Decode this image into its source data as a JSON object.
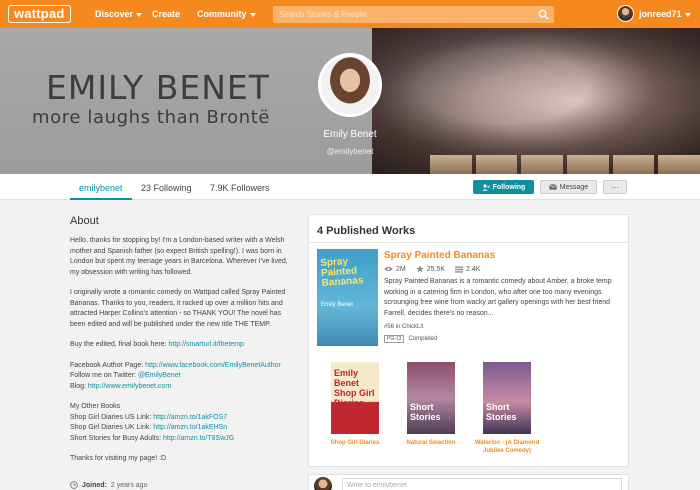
{
  "nav": {
    "logo": "wattpad",
    "discover": "Discover",
    "create": "Create",
    "community": "Community",
    "search_placeholder": "Search Stories & People",
    "username": "jonreed71"
  },
  "banner": {
    "title": "EMILY BENET",
    "tagline": "more laughs than Brontë",
    "name": "Emily Benet",
    "handle": "@emilybenet"
  },
  "tabs": {
    "handle": "emilybenet",
    "following": "23 Following",
    "followers": "7.9K Followers"
  },
  "actions": {
    "follow": "Following",
    "message": "Message",
    "more": "···"
  },
  "about": {
    "title": "About",
    "p1": "Hello, thanks for stopping by! I'm a London-based writer with a Welsh mother and Spanish father (so expect British spelling!). I was born in London but spent my teenage years in Barcelona. Wherever I've lived, my obsession with writing has followed.",
    "p2": "I originally wrote a romantic comedy on Wattpad called Spray Painted Bananas. Thanks to you, readers, it racked up over a million hits and attracted Harper Collins's attention - so THANK YOU! The novel has been edited and will be published under the new title THE TEMP.",
    "buy_label": "Buy the edited, final book here: ",
    "buy_link": "http://smarturl.it/thetemp",
    "fb_label": "Facebook Author Page: ",
    "fb_link": "http://www.facebook.com/EmilyBenetAuthor",
    "tw_label": "Follow me on Twitter: ",
    "tw_link": "@EmilyBenet",
    "blog_label": "Blog: ",
    "blog_link": "http://www.emilybenet.com",
    "other_title": "My Other Books",
    "us_label": "Shop Girl Diaries US Link: ",
    "us_link": "http://amzn.to/1akFOS7",
    "uk_label": "Shop Girl Diaries UK Link: ",
    "uk_link": "http://amzn.to/1akEHSn",
    "ss_label": "Short Stories for Busy Adults: ",
    "ss_link": "http://amzn.to/T8SwJG",
    "thanks": "Thanks for visiting my page! :D",
    "joined_label": "Joined:",
    "joined_value": "2 years ago"
  },
  "works": {
    "title": "4 Published Works",
    "featured": {
      "cover_text": "Spray Painted Bananas",
      "cover_author": "Emily Benet",
      "title": "Spray Painted Bananas",
      "reads": "2M",
      "votes": "25.5K",
      "parts": "2.4K",
      "description": "Spray Painted Bananas is a romantic comedy about Amber, a broke temp working in a catering firm in London, who after one too many evenings scrounging free wine from wacky art gallery openings with her best friend Farrell, decides there's no reason...",
      "rank": "#56 in ChickLit",
      "rating": "PG-13",
      "status": "Completed"
    },
    "books": [
      {
        "cover_text": "Emily Benet Shop Girl Diaries",
        "caption": "Shop Girl Diaries"
      },
      {
        "cover_text": "Short Stories",
        "caption": "Natural Selection"
      },
      {
        "cover_text": "Short Stories",
        "caption": "Waterloo - (A Diamond Jubilee Comedy)"
      }
    ]
  },
  "comment": {
    "placeholder": "Write to emilybenet"
  }
}
